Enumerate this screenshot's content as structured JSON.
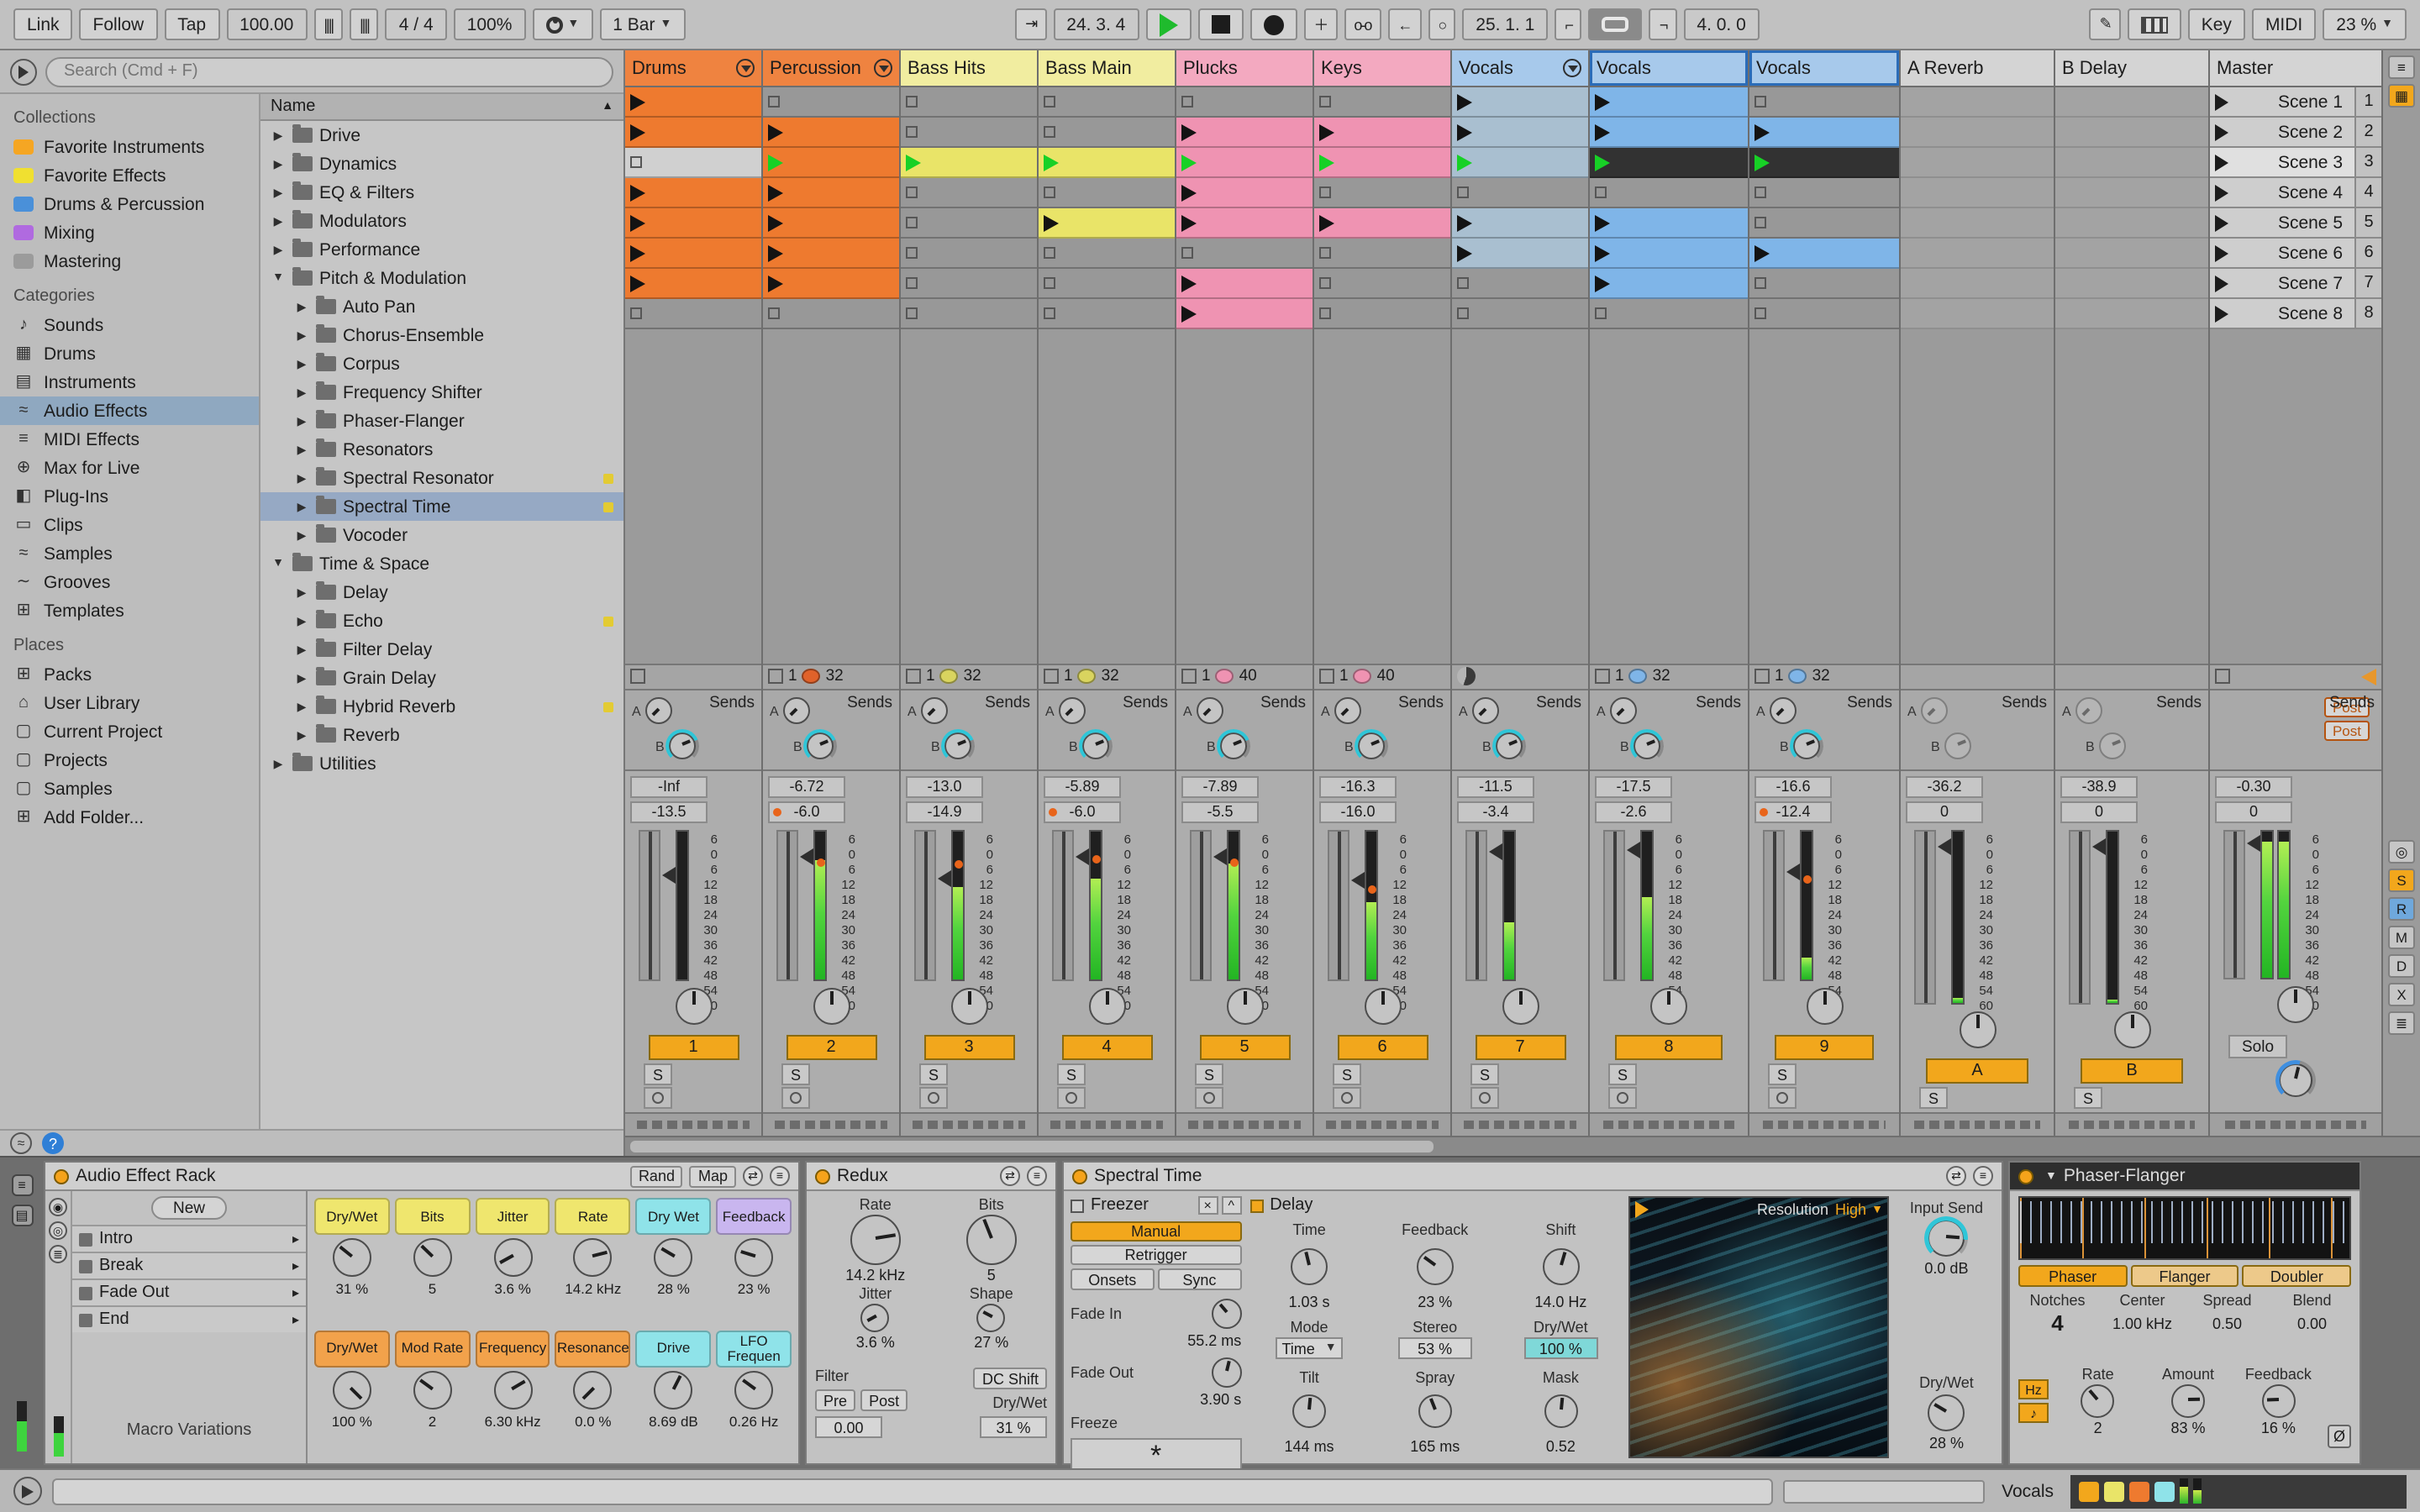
{
  "transport": {
    "link": "Link",
    "follow": "Follow",
    "tap": "Tap",
    "tempo": "100.00",
    "time_sig": "4 / 4",
    "groove_amount": "100%",
    "quantization": "1 Bar",
    "position": "24. 3. 4",
    "loop_start": "25. 1. 1",
    "loop_length": "4. 0. 0",
    "key": "Key",
    "midi": "MIDI",
    "cpu": "23 %"
  },
  "browser": {
    "search_placeholder": "Search (Cmd + F)",
    "sections": [
      {
        "title": "Collections",
        "items": [
          {
            "label": "Favorite Instruments",
            "color": "#f5a623"
          },
          {
            "label": "Favorite Effects",
            "color": "#f0e030"
          },
          {
            "label": "Drums & Percussion",
            "color": "#4a90d9"
          },
          {
            "label": "Mixing",
            "color": "#b06ae0"
          },
          {
            "label": "Mastering",
            "color": "#9b9b9b"
          }
        ]
      },
      {
        "title": "Categories",
        "items": [
          {
            "label": "Sounds",
            "icon": "note"
          },
          {
            "label": "Drums",
            "icon": "drum-grid"
          },
          {
            "label": "Instruments",
            "icon": "keys"
          },
          {
            "label": "Audio Effects",
            "icon": "audio-wave",
            "selected": true
          },
          {
            "label": "MIDI Effects",
            "icon": "midi"
          },
          {
            "label": "Max for Live",
            "icon": "max"
          },
          {
            "label": "Plug-Ins",
            "icon": "plug"
          },
          {
            "label": "Clips",
            "icon": "clip"
          },
          {
            "label": "Samples",
            "icon": "wave"
          },
          {
            "label": "Grooves",
            "icon": "groove"
          },
          {
            "label": "Templates",
            "icon": "template"
          }
        ]
      },
      {
        "title": "Places",
        "items": [
          {
            "label": "Packs",
            "icon": "pack"
          },
          {
            "label": "User Library",
            "icon": "home"
          },
          {
            "label": "Current Project",
            "icon": "folder"
          },
          {
            "label": "Projects",
            "icon": "folder"
          },
          {
            "label": "Samples",
            "icon": "folder"
          },
          {
            "label": "Add Folder...",
            "icon": "add-folder"
          }
        ]
      }
    ],
    "tree_header": "Name",
    "tree": [
      {
        "label": "Drive",
        "depth": 0,
        "caret": "right"
      },
      {
        "label": "Dynamics",
        "depth": 0,
        "caret": "right"
      },
      {
        "label": "EQ & Filters",
        "depth": 0,
        "caret": "right"
      },
      {
        "label": "Modulators",
        "depth": 0,
        "caret": "right"
      },
      {
        "label": "Performance",
        "depth": 0,
        "caret": "right"
      },
      {
        "label": "Pitch & Modulation",
        "depth": 0,
        "caret": "down"
      },
      {
        "label": "Auto Pan",
        "depth": 1,
        "caret": "right"
      },
      {
        "label": "Chorus-Ensemble",
        "depth": 1,
        "caret": "right"
      },
      {
        "label": "Corpus",
        "depth": 1,
        "caret": "right"
      },
      {
        "label": "Frequency Shifter",
        "depth": 1,
        "caret": "right"
      },
      {
        "label": "Phaser-Flanger",
        "depth": 1,
        "caret": "right"
      },
      {
        "label": "Resonators",
        "depth": 1,
        "caret": "right"
      },
      {
        "label": "Spectral Resonator",
        "depth": 1,
        "caret": "right",
        "fav": true
      },
      {
        "label": "Spectral Time",
        "depth": 1,
        "caret": "right",
        "fav": true,
        "selected": true
      },
      {
        "label": "Vocoder",
        "depth": 1,
        "caret": "right"
      },
      {
        "label": "Time & Space",
        "depth": 0,
        "caret": "down"
      },
      {
        "label": "Delay",
        "depth": 1,
        "caret": "right"
      },
      {
        "label": "Echo",
        "depth": 1,
        "caret": "right",
        "fav": true
      },
      {
        "label": "Filter Delay",
        "depth": 1,
        "caret": "right"
      },
      {
        "label": "Grain Delay",
        "depth": 1,
        "caret": "right"
      },
      {
        "label": "Hybrid Reverb",
        "depth": 1,
        "caret": "right",
        "fav": true
      },
      {
        "label": "Reverb",
        "depth": 1,
        "caret": "right"
      },
      {
        "label": "Utilities",
        "depth": 0,
        "caret": "right"
      }
    ]
  },
  "session": {
    "sends_label": "Sends",
    "send_letters": [
      "A",
      "B"
    ],
    "post_labels": [
      "Post",
      "Post"
    ],
    "db_scale": [
      "6",
      "0",
      "6",
      "12",
      "18",
      "24",
      "30",
      "36",
      "42",
      "48",
      "54",
      "60"
    ],
    "edge_letters": [
      "S",
      "R",
      "M",
      "D",
      "X"
    ],
    "tracks": [
      {
        "name": "Drums",
        "type": "audio",
        "width": 82,
        "color": "#ef8340",
        "clip_color": "#ee7a2f",
        "fold_icon": true,
        "clips": [
          "c",
          "c",
          "s",
          "c",
          "c",
          "c",
          "c",
          "e"
        ],
        "status": {
          "stop": true
        },
        "mixer": {
          "peak": "-Inf",
          "vol": "-13.5",
          "meter": 0,
          "fader": 0.3,
          "number": "1",
          "scale": true
        }
      },
      {
        "name": "Percussion",
        "type": "audio",
        "width": 82,
        "color": "#ef8340",
        "clip_color": "#ee7a2f",
        "fold_icon": true,
        "clips": [
          "e",
          "c",
          "p",
          "c",
          "c",
          "c",
          "c",
          "e"
        ],
        "status": {
          "stop": true,
          "pos": "1",
          "dot": "#e0622a",
          "len": "32"
        },
        "mixer": {
          "peak": "-6.72",
          "vol": "-6.0",
          "vol_dot": true,
          "meter": 0.8,
          "fader": 0.18,
          "number": "2",
          "scale": true,
          "marker": 0.19
        }
      },
      {
        "name": "Bass Hits",
        "type": "audio",
        "width": 82,
        "color": "#f1eda0",
        "clip_color": "#e9e468",
        "clips": [
          "e",
          "e",
          "p",
          "e",
          "e",
          "e",
          "e",
          "e"
        ],
        "status": {
          "stop": true,
          "pos": "1",
          "dot": "#d9d45f",
          "len": "32"
        },
        "mixer": {
          "peak": "-13.0",
          "vol": "-14.9",
          "meter": 0.62,
          "fader": 0.32,
          "number": "3",
          "scale": true,
          "marker": 0.2
        }
      },
      {
        "name": "Bass Main",
        "type": "audio",
        "width": 82,
        "color": "#f1eda0",
        "clip_color": "#e9e468",
        "clips": [
          "e",
          "e",
          "p",
          "e",
          "c",
          "e",
          "e",
          "e"
        ],
        "status": {
          "stop": true,
          "pos": "1",
          "dot": "#d9d45f",
          "len": "32"
        },
        "mixer": {
          "peak": "-5.89",
          "vol": "-6.0",
          "vol_dot": true,
          "meter": 0.68,
          "fader": 0.18,
          "number": "4",
          "scale": true,
          "marker": 0.16
        }
      },
      {
        "name": "Plucks",
        "type": "audio",
        "width": 82,
        "color": "#f3a9c0",
        "clip_color": "#ef93b2",
        "clips": [
          "e",
          "c",
          "p",
          "c",
          "c",
          "e",
          "c",
          "c"
        ],
        "status": {
          "stop": true,
          "pos": "1",
          "dot": "#ef93b2",
          "len": "40"
        },
        "mixer": {
          "peak": "-7.89",
          "vol": "-5.5",
          "meter": 0.78,
          "fader": 0.17,
          "number": "5",
          "scale": true,
          "marker": 0.19
        }
      },
      {
        "name": "Keys",
        "type": "audio",
        "width": 82,
        "color": "#f3a9c0",
        "clip_color": "#ef93b2",
        "clips": [
          "e",
          "c",
          "p",
          "e",
          "c",
          "e",
          "e",
          "e"
        ],
        "status": {
          "stop": true,
          "pos": "1",
          "dot": "#ef93b2",
          "len": "40"
        },
        "mixer": {
          "peak": "-16.3",
          "vol": "-16.0",
          "meter": 0.52,
          "fader": 0.33,
          "number": "6",
          "scale": true,
          "marker": 0.37
        }
      },
      {
        "name": "Vocals",
        "type": "audio",
        "width": 82,
        "color": "#a7c9eb",
        "clip_color": "#a9bfd0",
        "frozen": true,
        "fold_icon": true,
        "clips": [
          "h",
          "h",
          "hp",
          "e",
          "h",
          "h",
          "e",
          "e"
        ],
        "status": {
          "pie": true
        },
        "mixer": {
          "peak": "-11.5",
          "vol": "-3.4",
          "meter": 0.38,
          "fader": 0.14,
          "number": "7",
          "scale": false
        }
      },
      {
        "name": "Vocals",
        "type": "audio",
        "width": 95,
        "color": "#a7c9eb",
        "clip_color": "#7fb5e8",
        "selected": true,
        "clips": [
          "c",
          "c",
          "d",
          "e",
          "c",
          "c",
          "c",
          "e"
        ],
        "status": {
          "stop": true,
          "pos": "1",
          "dot": "#7fb5e8",
          "len": "32"
        },
        "mixer": {
          "peak": "-17.5",
          "vol": "-2.6",
          "meter": 0.55,
          "fader": 0.13,
          "number": "8",
          "scale": true
        }
      },
      {
        "name": "Vocals",
        "type": "audio",
        "width": 90,
        "color": "#a7c9eb",
        "clip_color": "#7fb5e8",
        "selected": true,
        "clips": [
          "e",
          "c",
          "d",
          "e",
          "e",
          "c",
          "e",
          "e"
        ],
        "status": {
          "stop": true,
          "pos": "1",
          "dot": "#7fb5e8",
          "len": "32"
        },
        "mixer": {
          "peak": "-16.6",
          "vol": "-12.4",
          "vol_dot": true,
          "meter": 0.15,
          "fader": 0.28,
          "number": "9",
          "scale": true,
          "marker": 0.3
        }
      },
      {
        "name": "A Reverb",
        "type": "return",
        "width": 92,
        "color": "#d4d4d4",
        "clips": [],
        "status": {},
        "mixer": {
          "peak": "-36.2",
          "vol": "0",
          "meter": 0.03,
          "fader": 0.09,
          "number": "A",
          "scale": true
        }
      },
      {
        "name": "B Delay",
        "type": "return",
        "width": 92,
        "color": "#d4d4d4",
        "clips": [],
        "status": {},
        "mixer": {
          "peak": "-38.9",
          "vol": "0",
          "meter": 0.02,
          "fader": 0.09,
          "number": "B",
          "scale": true
        }
      },
      {
        "name": "Master",
        "type": "master",
        "width": 103,
        "color": "#d4d4d4",
        "scenes": [
          "Scene 1",
          "Scene 2",
          "Scene 3",
          "Scene 4",
          "Scene 5",
          "Scene 6",
          "Scene 7",
          "Scene 8"
        ],
        "scene_numbers": [
          "1",
          "2",
          "3",
          "4",
          "5",
          "6",
          "7",
          "8"
        ],
        "selected_scene": 2,
        "status": {},
        "mixer": {
          "peak": "-0.30",
          "vol": "0",
          "meter": 0.93,
          "fader": 0.09,
          "solo": "Solo",
          "scale": true
        }
      }
    ]
  },
  "devices": {
    "rack": {
      "title": "Audio Effect Rack",
      "rand": "Rand",
      "map": "Map",
      "new_label": "New",
      "chains": [
        "Intro",
        "Break",
        "Fade Out",
        "End"
      ],
      "variations_label": "Macro Variations",
      "macros": [
        {
          "label": "Dry/Wet",
          "value": "31 %",
          "color": "#efe66e",
          "frac": 0.31
        },
        {
          "label": "Bits",
          "value": "5",
          "color": "#efe66e",
          "frac": 0.33
        },
        {
          "label": "Jitter",
          "value": "3.6 %",
          "color": "#efe66e",
          "frac": 0.06
        },
        {
          "label": "Rate",
          "value": "14.2 kHz",
          "color": "#efe66e",
          "frac": 0.78
        },
        {
          "label": "Dry Wet",
          "value": "28 %",
          "color": "#8fe3e9",
          "frac": 0.28
        },
        {
          "label": "Feedback",
          "value": "23 %",
          "color": "#c9b6ef",
          "frac": 0.23
        },
        {
          "label": "Dry/Wet",
          "value": "100 %",
          "color": "#f2a24b",
          "frac": 1
        },
        {
          "label": "Mod Rate",
          "value": "2",
          "color": "#f2a24b",
          "frac": 0.3
        },
        {
          "label": "Frequency",
          "value": "6.30 kHz",
          "color": "#f2a24b",
          "frac": 0.72
        },
        {
          "label": "Resonance",
          "value": "0.0 %",
          "color": "#f2a24b",
          "frac": 0
        },
        {
          "label": "Drive",
          "value": "8.69 dB",
          "color": "#8fe3e9",
          "frac": 0.6
        },
        {
          "label": "LFO Frequen",
          "value": "0.26 Hz",
          "color": "#8fe3e9",
          "frac": 0.3
        }
      ]
    },
    "redux": {
      "title": "Redux",
      "rate_label": "Rate",
      "rate_value": "14.2 kHz",
      "rate_frac": 0.8,
      "jitter_label": "Jitter",
      "jitter_value": "3.6 %",
      "jitter_frac": 0.06,
      "bits_label": "Bits",
      "bits_value": "5",
      "bits_frac": 0.42,
      "shape_label": "Shape",
      "shape_value": "27 %",
      "shape_frac": 0.27,
      "filter_label": "Filter",
      "pre": "Pre",
      "post": "Post",
      "filter_value": "0.00",
      "dc_shift": "DC Shift",
      "drywet_label": "Dry/Wet",
      "drywet_value": "31 %"
    },
    "spectral_time": {
      "title": "Spectral Time",
      "freezer_label": "Freezer",
      "manual": "Manual",
      "retrigger": "Retrigger",
      "onsets": "Onsets",
      "sync": "Sync",
      "fade_in_label": "Fade In",
      "fade_in": "55.2 ms",
      "fade_in_frac": 0.35,
      "fade_out_label": "Fade Out",
      "fade_out": "3.90 s",
      "fade_out_frac": 0.55,
      "freeze_label": "Freeze",
      "delay_label": "Delay",
      "time_label": "Time",
      "time": "1.03 s",
      "time_frac": 0.45,
      "feedback_label": "Feedback",
      "feedback": "23 %",
      "feedback_frac": 0.3,
      "shift_label": "Shift",
      "shift": "14.0 Hz",
      "shift_frac": 0.56,
      "mode_label": "Mode",
      "mode": "Time",
      "stereo_label": "Stereo",
      "stereo": "53 %",
      "drywet_label": "Dry/Wet",
      "drywet": "100 %",
      "tilt_label": "Tilt",
      "tilt": "144 ms",
      "tilt_frac": 0.52,
      "spray_label": "Spray",
      "spray": "165 ms",
      "spray_frac": 0.42,
      "mask_label": "Mask",
      "mask": "0.52",
      "mask_frac": 0.52,
      "resolution_label": "Resolution",
      "resolution": "High",
      "input_send_label": "Input Send",
      "input_send": "0.0 dB",
      "input_send_frac": 0.85,
      "out_drywet_label": "Dry/Wet",
      "out_drywet": "28 %",
      "out_drywet_frac": 0.28
    },
    "phaser": {
      "title": "Phaser-Flanger",
      "tabs": [
        "Phaser",
        "Flanger",
        "Doubler"
      ],
      "notches_label": "Notches",
      "notches": "4",
      "center_label": "Center",
      "center": "1.00 kHz",
      "spread_label": "Spread",
      "spread": "0.50",
      "blend_label": "Blend",
      "blend": "0.00",
      "hz": "Hz",
      "note": "♪",
      "rate_label": "Rate",
      "rate": "2",
      "rate_frac": 0.35,
      "amount_label": "Amount",
      "amount": "83 %",
      "amount_frac": 0.83,
      "fb_label": "Feedback",
      "fb": "16 %",
      "fb_frac": 0.16
    }
  },
  "status_bar": {
    "selected_track": "Vocals",
    "mini_devices": [
      "#f2a71c",
      "#e9e468",
      "#ee7a2f",
      "#8fe3e9"
    ]
  }
}
